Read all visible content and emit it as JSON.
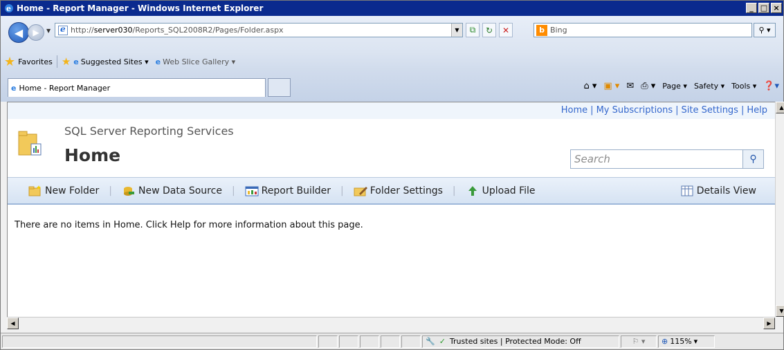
{
  "window": {
    "title": "Home - Report Manager - Windows Internet Explorer"
  },
  "address": {
    "url_prefix": "http://",
    "url_host": "server030",
    "url_path": "/Reports_SQL2008R2/Pages/Folder.aspx"
  },
  "search_provider": {
    "name": "Bing"
  },
  "favorites": {
    "label": "Favorites",
    "suggested": "Suggested Sites ▾",
    "webslice": "Web Slice Gallery ▾"
  },
  "tab": {
    "title": "Home - Report Manager"
  },
  "commandbar": {
    "page": "Page ▾",
    "safety": "Safety ▾",
    "tools": "Tools ▾"
  },
  "topnav": {
    "home": "Home",
    "subscriptions": "My Subscriptions",
    "settings": "Site Settings",
    "help": "Help"
  },
  "header": {
    "product": "SQL Server Reporting Services",
    "title": "Home",
    "search_placeholder": "Search"
  },
  "toolbar": {
    "new_folder": "New Folder",
    "new_data_source": "New Data Source",
    "report_builder": "Report Builder",
    "folder_settings": "Folder Settings",
    "upload_file": "Upload File",
    "details_view": "Details View"
  },
  "message": "There are no items in Home. Click Help for more information about this page.",
  "status": {
    "zone": "Trusted sites | Protected Mode: Off",
    "zoom": "115%"
  },
  "colors": {
    "title_bar": "#0a2a8e",
    "link": "#3366cc"
  }
}
